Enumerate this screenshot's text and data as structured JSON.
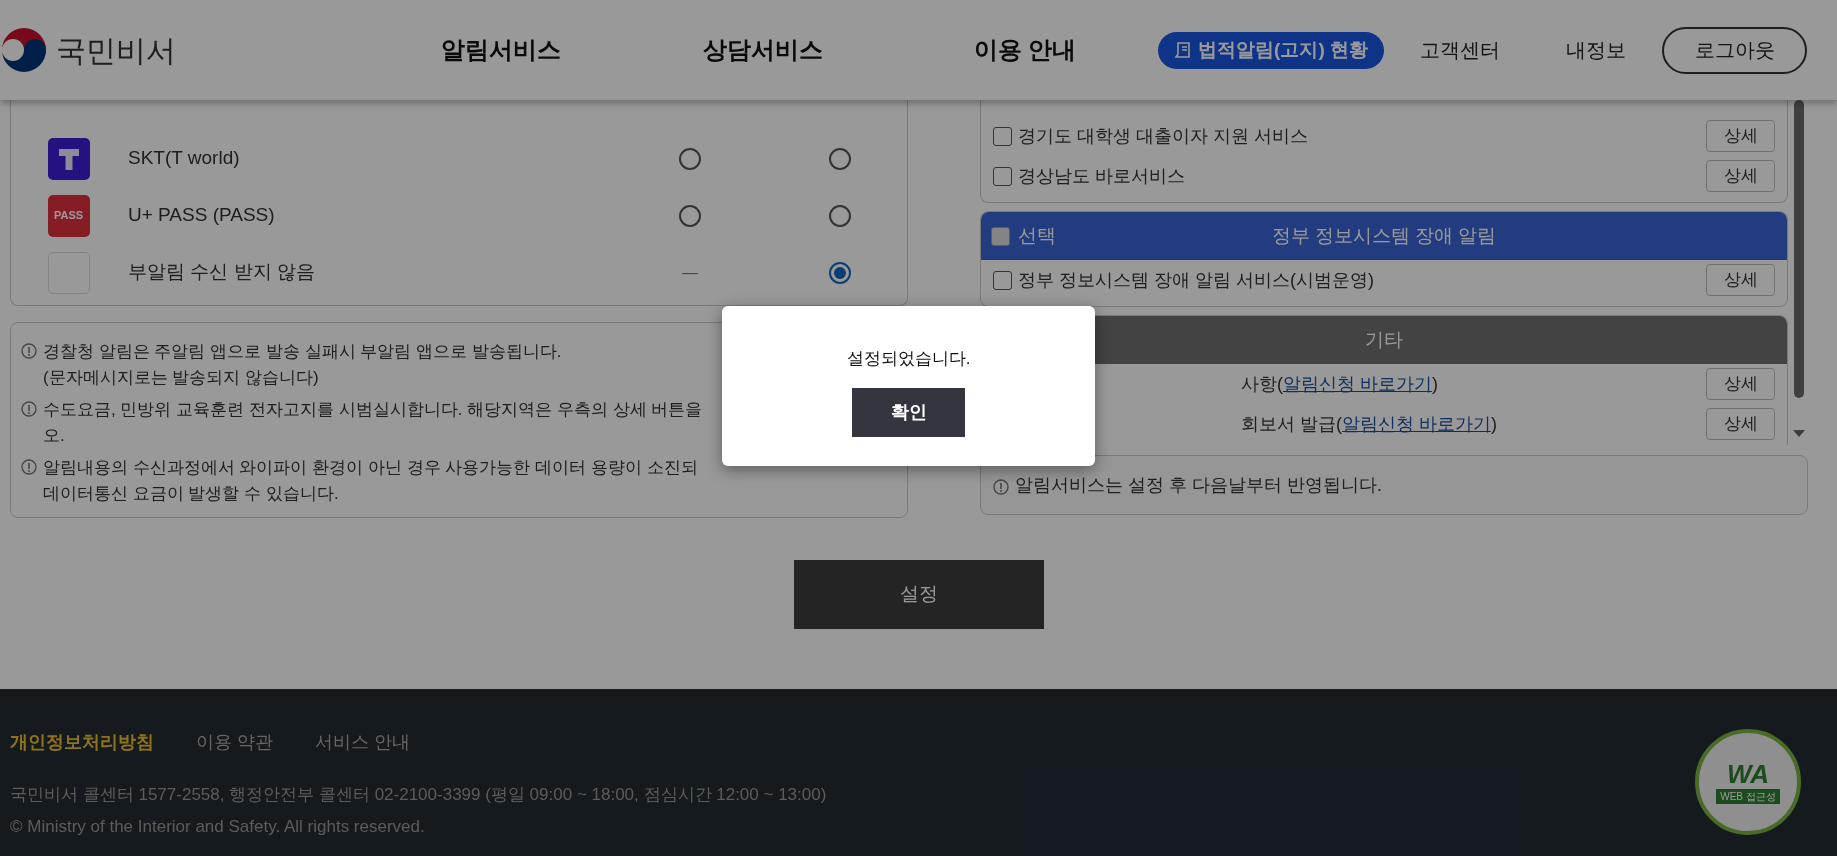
{
  "header": {
    "logo_text": "국민비서",
    "nav": [
      "알림서비스",
      "상담서비스",
      "이용 안내"
    ],
    "legal_notice_button": "법적알림(고지) 현황",
    "links": [
      "고객센터",
      "내정보"
    ],
    "logout_button": "로그아웃"
  },
  "app_table": {
    "rows": [
      {
        "kind": "tworld",
        "name": "SKT(T world)",
        "main": {
          "kind": "radio",
          "selected": false
        },
        "sub": {
          "kind": "radio",
          "selected": false
        }
      },
      {
        "kind": "pass",
        "icon_text": "PASS",
        "name": "U+ PASS (PASS)",
        "main": {
          "kind": "radio",
          "selected": false
        },
        "sub": {
          "kind": "radio",
          "selected": false
        }
      },
      {
        "kind": "blank",
        "name": "부알림 수신 받지 않음",
        "main": {
          "kind": "dash",
          "text": "—"
        },
        "sub": {
          "kind": "radio",
          "selected": true
        }
      }
    ]
  },
  "notes": [
    {
      "lines": [
        "경찰청 알림은 주알림 앱으로 발송 실패시 부알림 앱으로 발송됩니다.",
        "(문자메시지로는 발송되지 않습니다)"
      ]
    },
    {
      "lines": [
        "수도요금, 민방위 교육훈련 전자고지를 시범실시합니다. 해당지역은 우측의 상세 버튼을",
        "오."
      ]
    },
    {
      "lines": [
        "알림내용의 수신과정에서 와이파이 환경이 아닌 경우 사용가능한 데이터 용량이 소진되",
        "데이터통신 요금이 발생할 수 있습니다."
      ]
    }
  ],
  "services": {
    "groups": [
      {
        "rows": [
          {
            "kind": "checkbox",
            "label": "경기도 대학생 대출이자 지원 서비스",
            "checked": false,
            "detail_button": "상세"
          },
          {
            "kind": "checkbox",
            "label": "경상남도 바로서비스",
            "checked": false,
            "detail_button": "상세"
          }
        ]
      },
      {
        "header": {
          "kind": "primary",
          "select_label": "선택",
          "select_checked": false,
          "title": "정부 정보시스템 장애 알림"
        },
        "rows": [
          {
            "kind": "checkbox",
            "label": "정부 정보시스템 장애 알림 서비스(시범운영)",
            "checked": false,
            "detail_button": "상세"
          }
        ]
      },
      {
        "header": {
          "kind": "secondary",
          "title": "기타"
        },
        "rows": [
          {
            "kind": "link",
            "prefix": "사항(",
            "link": "알림신청 바로가기",
            "suffix": ")",
            "detail_button": "상세"
          },
          {
            "kind": "link",
            "prefix": "회보서 발급(",
            "link": "알림신청 바로가기",
            "suffix": ")",
            "detail_button": "상세"
          }
        ]
      }
    ]
  },
  "service_note": "알림서비스는 설정 후 다음날부터 반영됩니다.",
  "submit_button": "설정",
  "footer": {
    "links": [
      {
        "label": "개인정보처리방침",
        "highlighted": true
      },
      {
        "label": "이용 약관",
        "highlighted": false
      },
      {
        "label": "서비스 안내",
        "highlighted": false
      }
    ],
    "contact": "국민비서 콜센터 1577-2558, 행정안전부 콜센터 02-2100-3399 (평일 09:00 ~ 18:00, 점심시간 12:00 ~ 13:00)",
    "copyright": "© Ministry of the Interior and Safety. All rights reserved.",
    "badge": {
      "mark": "WA",
      "caption": "WEB 접근성"
    }
  },
  "dialog": {
    "message": "설정되었습니다.",
    "confirm_button": "확인"
  }
}
